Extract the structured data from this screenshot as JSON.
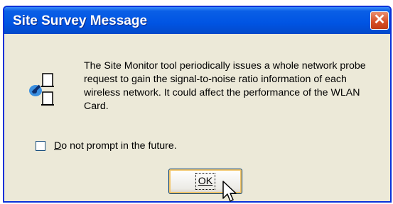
{
  "dialog": {
    "title": "Site Survey Message",
    "close_glyph": "✕",
    "message": "The Site Monitor tool periodically issues a whole network probe request to gain the signal-to-noise ratio information of each wireless network. It could affect the performance of the WLAN Card.",
    "checkbox": {
      "label_accel": "D",
      "label_rest": "o not prompt in the future.",
      "checked": false
    },
    "ok_button": {
      "label": "OK"
    }
  },
  "icons": {
    "message_icon": "wireless-info-icon",
    "cursor": "mouse-pointer-icon"
  },
  "colors": {
    "titlebar": "#0054e3",
    "close_button": "#d54d24",
    "window_face": "#ece9d8",
    "focus_border": "#f4c66a"
  }
}
